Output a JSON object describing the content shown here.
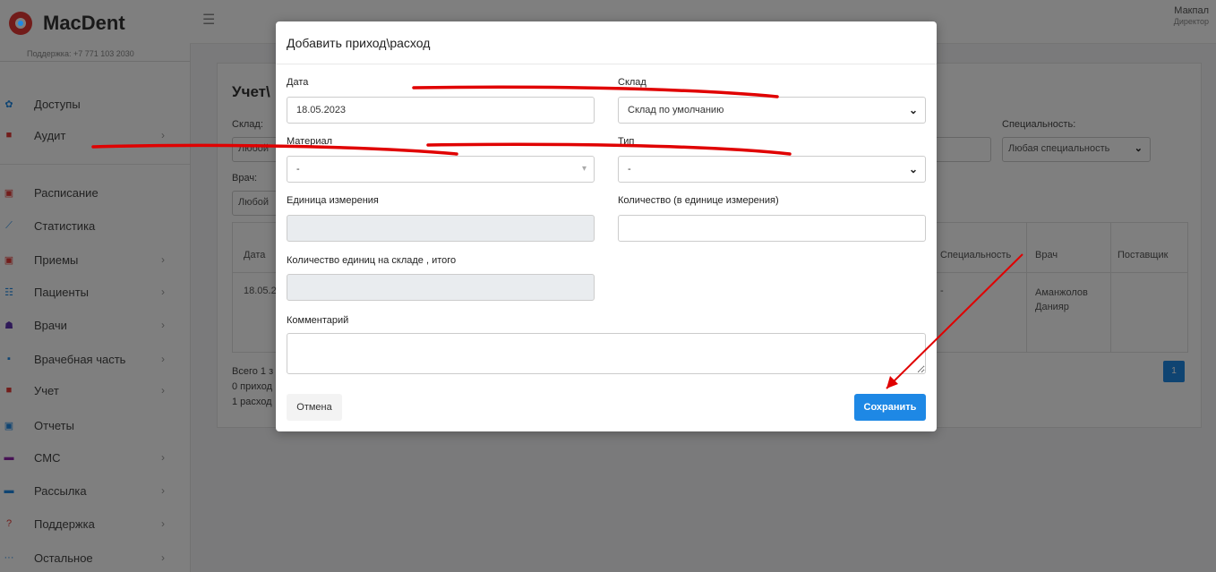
{
  "app": {
    "logo_text": "MacDent",
    "support": "Поддержка: +7 771 103 2030"
  },
  "user": {
    "name": "Макпал",
    "role": "Директор"
  },
  "sidebar": {
    "items": [
      {
        "label": "Доступы",
        "icon": "gear-icon",
        "color": "#1e88e5",
        "chevron": false
      },
      {
        "label": "Аудит",
        "icon": "bag-icon",
        "color": "#e53935",
        "chevron": true
      },
      {
        "label": "Расписание",
        "icon": "calendar-icon",
        "color": "#e53935",
        "chevron": false
      },
      {
        "label": "Статистика",
        "icon": "chart-icon",
        "color": "#1e88e5",
        "chevron": false
      },
      {
        "label": "Приемы",
        "icon": "calendar-icon",
        "color": "#e53935",
        "chevron": true
      },
      {
        "label": "Пациенты",
        "icon": "users-icon",
        "color": "#1e88e5",
        "chevron": true
      },
      {
        "label": "Врачи",
        "icon": "user-icon",
        "color": "#5e35b1",
        "chevron": true
      },
      {
        "label": "Врачебная часть",
        "icon": "briefcase-icon",
        "color": "#1e88e5",
        "chevron": true
      },
      {
        "label": "Учет",
        "icon": "bag-icon",
        "color": "#e53935",
        "chevron": true
      },
      {
        "label": "Отчеты",
        "icon": "calendar-icon",
        "color": "#1e88e5",
        "chevron": false
      },
      {
        "label": "СМС",
        "icon": "message-icon",
        "color": "#8e24aa",
        "chevron": true
      },
      {
        "label": "Рассылка",
        "icon": "message-icon",
        "color": "#1e88e5",
        "chevron": true
      },
      {
        "label": "Поддержка",
        "icon": "question-icon",
        "color": "#e53935",
        "chevron": true
      },
      {
        "label": "Остальное",
        "icon": "dots-icon",
        "color": "#1e88e5",
        "chevron": true
      }
    ]
  },
  "panel": {
    "title": "Учет\\",
    "warehouse_label": "Склад:",
    "warehouse_value": "Любой",
    "doctor_label": "Врач:",
    "doctor_value": "Любой",
    "specialty_label": "Специальность:",
    "specialty_value": "Любая специальность",
    "table": {
      "headers": [
        "Дата",
        "Специальность",
        "Врач",
        "Поставщик"
      ],
      "row": {
        "date": "18.05.2",
        "specialty": "-",
        "doctor": "Аманжолов Данияр"
      }
    },
    "summary": [
      "Всего 1 з",
      "0 приход",
      "1 расход"
    ],
    "page": "1"
  },
  "modal": {
    "title": "Добавить приход\\расход",
    "date_label": "Дата",
    "date_value": "18.05.2023",
    "warehouse_label": "Склад",
    "warehouse_value": "Склад по умолчанию",
    "material_label": "Материал",
    "material_value": "-",
    "type_label": "Тип",
    "type_value": "-",
    "unit_label": "Единица измерения",
    "unit_value": "",
    "quantity_label": "Количество (в единице измерения)",
    "quantity_value": "",
    "stock_label": "Количество единиц на складе , итого",
    "stock_value": "",
    "comment_label": "Комментарий",
    "comment_value": "",
    "cancel_label": "Отмена",
    "save_label": "Сохранить"
  },
  "colors": {
    "accent": "#1e88e5",
    "brand": "#e53935",
    "annotation": "#e00000"
  }
}
